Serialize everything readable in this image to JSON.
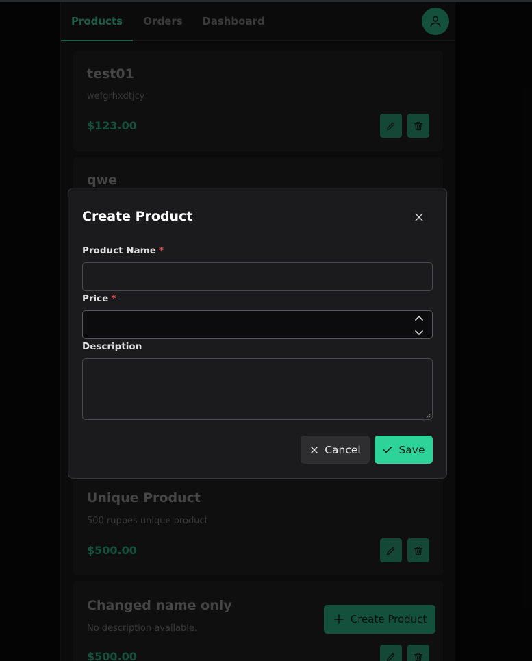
{
  "nav": {
    "tabs": [
      "Products",
      "Orders",
      "Dashboard"
    ],
    "active_tab": "Products"
  },
  "products": [
    {
      "name": "test01",
      "description": "wefgrhxdtjcy",
      "price": "$123.00"
    },
    {
      "name": "qwe",
      "description": "",
      "price": ""
    },
    {
      "name": "Unique Product",
      "description": "500 ruppes unique product",
      "price": "$500.00"
    },
    {
      "name": "Changed name only",
      "description": "No description available.",
      "price": "$500.00"
    }
  ],
  "create_button_label": "Create Product",
  "modal": {
    "title": "Create Product",
    "fields": {
      "name_label": "Product Name",
      "price_label": "Price",
      "description_label": "Description",
      "required_mark": "*",
      "name_value": "",
      "price_value": "",
      "description_value": ""
    },
    "cancel_label": "Cancel",
    "save_label": "Save"
  },
  "colors": {
    "accent": "#2ed39a",
    "accent_dim": "#1f7d5c",
    "required": "#e04848"
  },
  "icons": {
    "avatar": "user-icon",
    "edit": "pencil-icon",
    "delete": "trash-icon",
    "close": "close-icon",
    "add": "plus-icon",
    "save": "check-icon"
  }
}
